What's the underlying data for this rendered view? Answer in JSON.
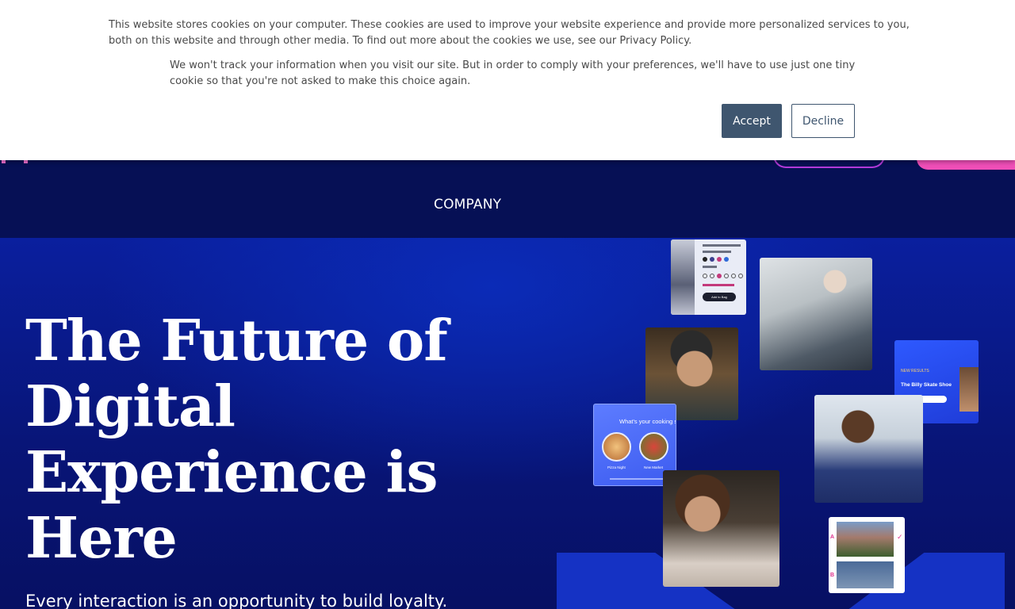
{
  "cookie_banner": {
    "message": "This website stores cookies on your computer. These cookies are used to improve your website experience and provide more personalized services to you, both on this website and through other media. To find out more about the cookies we use, see our Privacy Policy.",
    "preference_message": "We won't track your information when you visit our site. But in order to comply with your preferences, we'll have to use just one tiny cookie so that you're not asked to make this choice again.",
    "accept_label": "Accept",
    "decline_label": "Decline"
  },
  "nav": {
    "company_label": "COMPANY"
  },
  "hero": {
    "title": "The Future of Digital Experience is Here",
    "subtitle": "Every interaction is an opportunity to build loyalty."
  },
  "collage": {
    "product_card": {
      "button_label": "Add to Bag"
    },
    "skate_card": {
      "tag": "NEW RESULTS",
      "product_name": "The Billy Skate Shoe"
    },
    "cooking_card": {
      "question": "What's your cooking s",
      "option_a": "Pizza Night",
      "option_b": "New Market"
    },
    "ab_card": {
      "label_a": "A",
      "label_b": "B"
    }
  },
  "colors": {
    "nav_background": "#061055",
    "hero_background": "#0a1f9e",
    "accept_button": "#3f566f",
    "brand_pink": "#f04fb8",
    "brand_purple": "#b33ad9"
  }
}
